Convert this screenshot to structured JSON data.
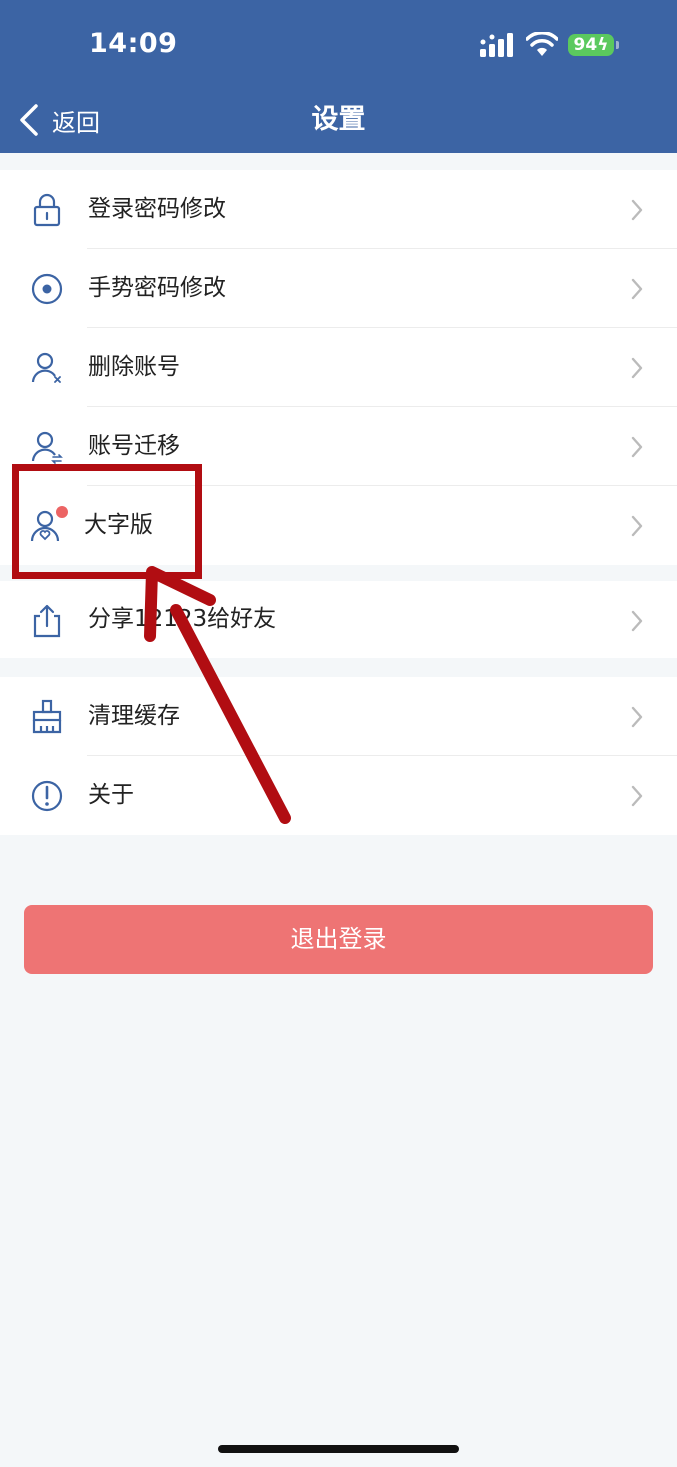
{
  "status_bar": {
    "time": "14:09",
    "battery": "94"
  },
  "header": {
    "back_label": "返回",
    "title": "设置"
  },
  "settings": {
    "group1": [
      {
        "label": "登录密码修改",
        "icon": "lock-icon"
      },
      {
        "label": "手势密码修改",
        "icon": "gesture-dot-icon"
      },
      {
        "label": "删除账号",
        "icon": "delete-user-icon"
      },
      {
        "label": "账号迁移",
        "icon": "migrate-user-icon"
      },
      {
        "label": "大字版",
        "icon": "elder-mode-icon",
        "badge": true
      }
    ],
    "group2": [
      {
        "label": "分享12123给好友",
        "icon": "share-icon"
      }
    ],
    "group3": [
      {
        "label": "清理缓存",
        "icon": "broom-icon"
      },
      {
        "label": "关于",
        "icon": "info-icon"
      }
    ]
  },
  "logout_label": "退出登录",
  "colors": {
    "header_bg": "#3c64a4",
    "logout_bg": "#ee7474",
    "annotation": "#b10d12",
    "battery": "#5bc95e"
  }
}
